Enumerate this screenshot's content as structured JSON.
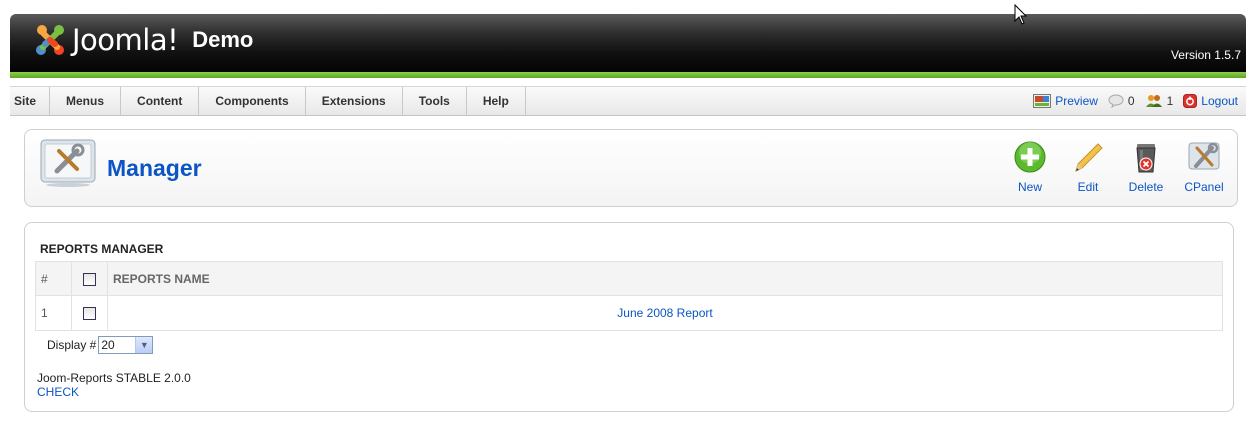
{
  "header": {
    "logo_text": "Joomla!",
    "site_name": "Demo",
    "version": "Version 1.5.7"
  },
  "menu": {
    "items": [
      {
        "label": "Site"
      },
      {
        "label": "Menus"
      },
      {
        "label": "Content"
      },
      {
        "label": "Components"
      },
      {
        "label": "Extensions"
      },
      {
        "label": "Tools"
      },
      {
        "label": "Help"
      }
    ]
  },
  "status": {
    "preview_label": "Preview",
    "messages_count": "0",
    "users_count": "1",
    "logout_label": "Logout"
  },
  "toolbar": {
    "title": "Manager",
    "buttons": [
      {
        "label": "New",
        "icon": "new-icon"
      },
      {
        "label": "Edit",
        "icon": "edit-icon"
      },
      {
        "label": "Delete",
        "icon": "delete-icon"
      },
      {
        "label": "CPanel",
        "icon": "cpanel-icon"
      }
    ]
  },
  "reports": {
    "section_title": "REPORTS MANAGER",
    "columns": {
      "num": "#",
      "name": "REPORTS NAME"
    },
    "rows": [
      {
        "num": "1",
        "name": "June 2008 Report"
      }
    ],
    "display_label": "Display #",
    "display_value": "20"
  },
  "footer": {
    "version_text": "Joom-Reports STABLE 2.0.0",
    "check_link": "CHECK"
  },
  "colors": {
    "link": "#0b55c4",
    "accent_green": "#6ab42e",
    "header_bg": "#000000"
  }
}
